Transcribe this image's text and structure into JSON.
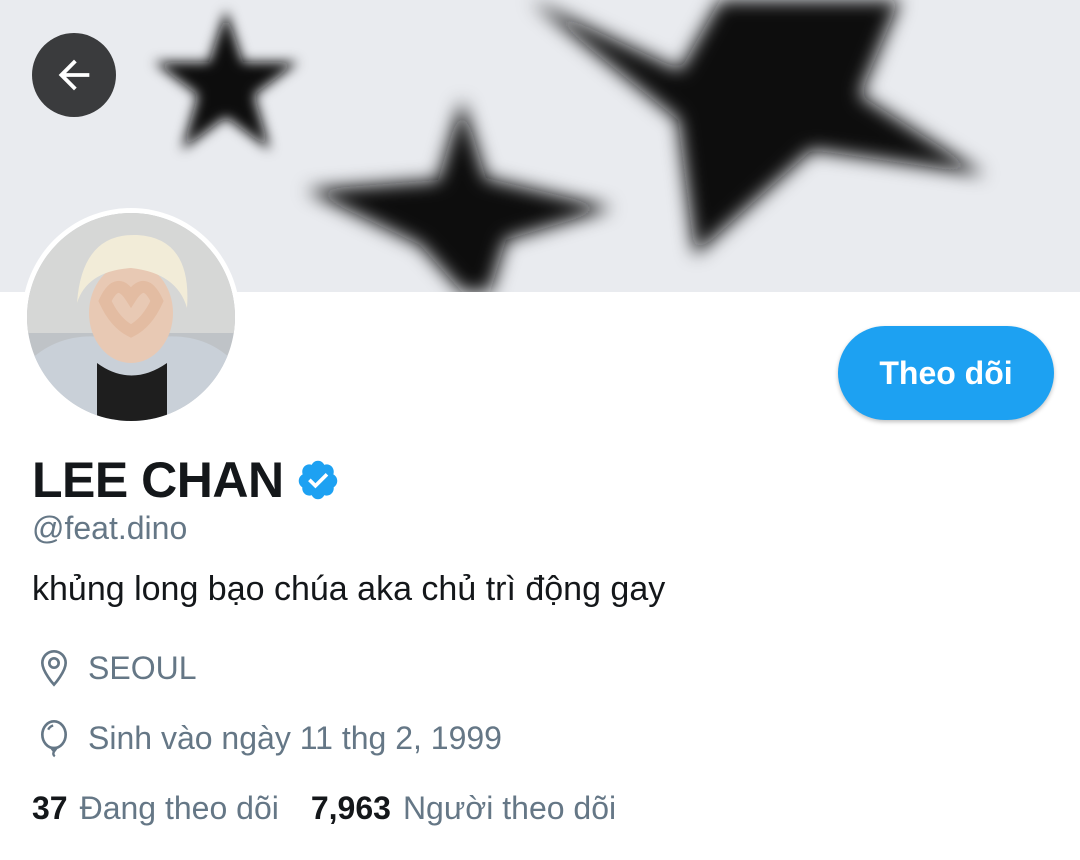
{
  "header": {
    "back_icon": "arrow-left-icon"
  },
  "profile": {
    "display_name": "LEE CHAN",
    "verified": true,
    "handle": "@feat.dino",
    "bio": "khủng long bạo chúa aka chủ trì động gay",
    "location": "SEOUL",
    "birthday": "Sinh vào ngày 11 thg 2, 1999",
    "follow_label": "Theo dõi"
  },
  "stats": {
    "following_count": "37",
    "following_label": "Đang theo dõi",
    "followers_count": "7,963",
    "followers_label": "Người theo dõi"
  },
  "colors": {
    "accent": "#1da1f2",
    "secondary_text": "#657786",
    "primary_text": "#14171a",
    "back_button": "#3a3b3d"
  }
}
